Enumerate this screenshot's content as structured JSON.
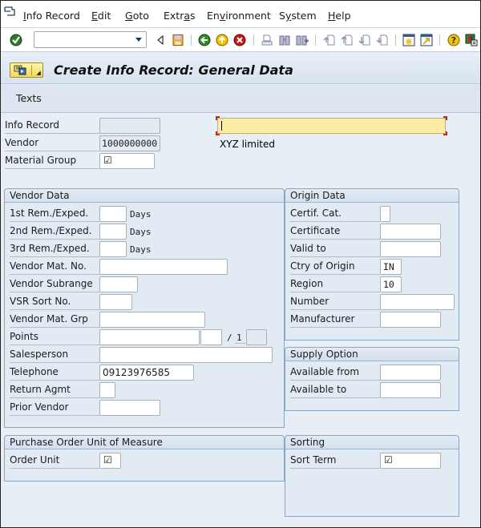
{
  "menubar": {
    "items": [
      {
        "label": "Info Record",
        "mnemonic": "I"
      },
      {
        "label": "Edit",
        "mnemonic": "E"
      },
      {
        "label": "Goto",
        "mnemonic": "G"
      },
      {
        "label": "Extras",
        "mnemonic": "a"
      },
      {
        "label": "Environment",
        "mnemonic": "v"
      },
      {
        "label": "System",
        "mnemonic": "y"
      },
      {
        "label": "Help",
        "mnemonic": "H"
      }
    ]
  },
  "toolbar": {
    "command_field_value": "",
    "icons": [
      "enter-icon",
      "back-arrow-icon",
      "save-icon",
      "back-icon",
      "exit-icon",
      "cancel-icon",
      "print-icon",
      "find-icon",
      "find-next-icon",
      "first-page-icon",
      "previous-page-icon",
      "next-page-icon",
      "last-page-icon",
      "create-session-icon",
      "shortcut-icon",
      "help-icon",
      "customize-layout-icon"
    ]
  },
  "title": {
    "text": "Create Info Record: General Data"
  },
  "app_toolbar": {
    "texts_label": "Texts"
  },
  "header": {
    "info_record": {
      "label": "Info Record",
      "value": ""
    },
    "vendor": {
      "label": "Vendor",
      "value": "1000000000",
      "name": "XYZ limited"
    },
    "material_group": {
      "label": "Material Group",
      "value": "☑"
    },
    "material_field_value": ""
  },
  "vendor_data": {
    "title": "Vendor Data",
    "first_rem": {
      "label": "1st Rem./Exped.",
      "value": "",
      "unit": "Days"
    },
    "second_rem": {
      "label": "2nd Rem./Exped.",
      "value": "",
      "unit": "Days"
    },
    "third_rem": {
      "label": "3rd Rem./Exped.",
      "value": "",
      "unit": "Days"
    },
    "vendor_mat_no": {
      "label": "Vendor Mat. No.",
      "value": ""
    },
    "vendor_subrange": {
      "label": "Vendor Subrange",
      "value": ""
    },
    "vsr_sort_no": {
      "label": "VSR Sort No.",
      "value": ""
    },
    "vendor_mat_grp": {
      "label": "Vendor Mat. Grp",
      "value": ""
    },
    "points": {
      "label": "Points",
      "value": "",
      "unit": "",
      "separator": "/",
      "per": "1",
      "per_unit": ""
    },
    "salesperson": {
      "label": "Salesperson",
      "value": ""
    },
    "telephone": {
      "label": "Telephone",
      "value": "09123976585"
    },
    "return_agmt": {
      "label": "Return Agmt",
      "value": ""
    },
    "prior_vendor": {
      "label": "Prior Vendor",
      "value": ""
    }
  },
  "origin_data": {
    "title": "Origin Data",
    "certif_cat": {
      "label": "Certif. Cat.",
      "value": ""
    },
    "certificate": {
      "label": "Certificate",
      "value": ""
    },
    "valid_to": {
      "label": "Valid to",
      "value": ""
    },
    "ctry_of_origin": {
      "label": "Ctry of Origin",
      "value": "IN"
    },
    "region": {
      "label": "Region",
      "value": "10"
    },
    "number": {
      "label": "Number",
      "value": ""
    },
    "manufacturer": {
      "label": "Manufacturer",
      "value": ""
    }
  },
  "supply_option": {
    "title": "Supply Option",
    "available_from": {
      "label": "Available from",
      "value": ""
    },
    "available_to": {
      "label": "Available to",
      "value": ""
    }
  },
  "po_unit": {
    "title": "Purchase Order Unit of Measure",
    "order_unit": {
      "label": "Order Unit",
      "value": "☑"
    }
  },
  "sorting": {
    "title": "Sorting",
    "sort_term": {
      "label": "Sort Term",
      "value": "☑"
    }
  }
}
